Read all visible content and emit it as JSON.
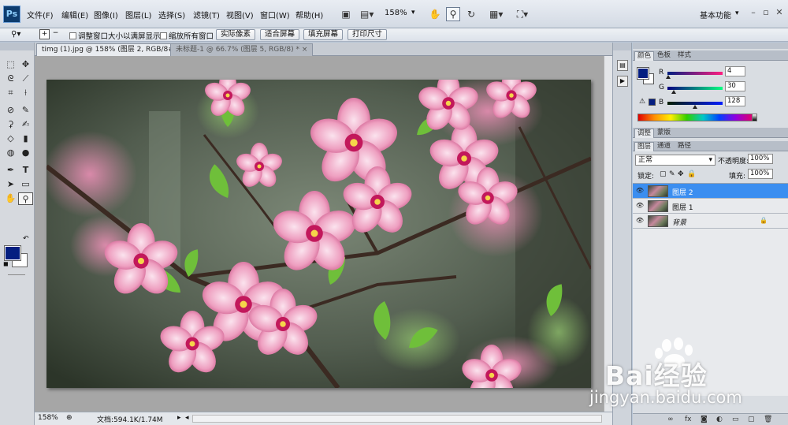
{
  "app": {
    "logo": "Ps"
  },
  "menu": {
    "items": [
      "文件(F)",
      "编辑(E)",
      "图像(I)",
      "图层(L)",
      "选择(S)",
      "滤镜(T)",
      "视图(V)",
      "窗口(W)",
      "帮助(H)"
    ],
    "zoom": "158%",
    "workspace": "基本功能"
  },
  "options": {
    "resize_windows": "调整窗口大小以满屏显示",
    "zoom_all": "缩放所有窗口",
    "actual_pixels": "实际像素",
    "fit_screen": "适合屏幕",
    "fill_screen": "填充屏幕",
    "print_size": "打印尺寸"
  },
  "documents": [
    {
      "label": "timg (1).jpg @ 158% (图层 2, RGB/8#) *",
      "active": true
    },
    {
      "label": "未标题-1 @ 66.7% (图层 5, RGB/8) *",
      "active": false
    }
  ],
  "status": {
    "zoom": "158%",
    "doc_size": "文档:594.1K/1.74M"
  },
  "color_panel": {
    "tabs": [
      "颜色",
      "色板",
      "样式"
    ],
    "active_tab": "颜色",
    "r_label": "R",
    "g_label": "G",
    "b_label": "B",
    "r": "4",
    "g": "30",
    "b": "128",
    "r_fraction": 0.016,
    "g_fraction": 0.118,
    "b_fraction": 0.502,
    "foreground": "#041e80",
    "background": "#ffffff"
  },
  "adjust_panel": {
    "tabs": [
      "调整",
      "蒙版"
    ]
  },
  "layers_panel": {
    "tabs": [
      "图层",
      "通道",
      "路径"
    ],
    "blend_mode": "正常",
    "opacity_label": "不透明度:",
    "opacity": "100%",
    "lock_label": "锁定:",
    "fill_label": "填充:",
    "fill": "100%",
    "layers": [
      {
        "name": "图层 2",
        "selected": true,
        "locked": false
      },
      {
        "name": "图层 1",
        "selected": false,
        "locked": false
      },
      {
        "name": "背景",
        "selected": false,
        "locked": true
      }
    ]
  },
  "watermark": {
    "text": "Bai经验",
    "url": "jingyan.baidu.com"
  },
  "colors": {
    "selection": "#3b8ef0",
    "canvas_bg": "#a6a6a6"
  }
}
